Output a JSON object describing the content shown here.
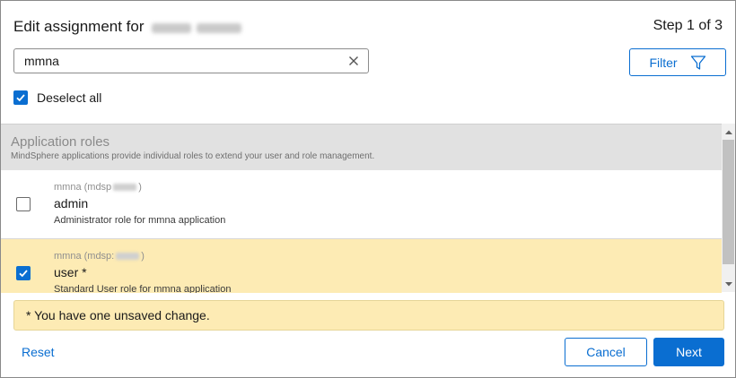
{
  "dialog": {
    "title": "Edit assignment for",
    "step": "Step 1 of 3"
  },
  "search": {
    "value": "mmna",
    "clear_icon": "close-icon"
  },
  "filter": {
    "label": "Filter",
    "icon": "funnel-icon"
  },
  "deselect_all": {
    "label": "Deselect all",
    "checked": true
  },
  "group": {
    "title": "Application roles",
    "subtitle": "MindSphere applications provide individual roles to extend your user and role management."
  },
  "roles": [
    {
      "app_prefix": "mmna (mdsp",
      "app_suffix": ")",
      "name": "admin",
      "description": "Administrator role for mmna application",
      "checked": false
    },
    {
      "app_prefix": "mmna (mdsp:",
      "app_suffix": ")",
      "name": "user *",
      "description": "Standard User role for mmna application",
      "checked": true
    }
  ],
  "notice": "* You have one unsaved change.",
  "footer": {
    "reset": "Reset",
    "cancel": "Cancel",
    "next": "Next"
  },
  "colors": {
    "accent": "#0a6ed1",
    "selected_row": "#fdebb4",
    "group_header": "#e1e1e1"
  }
}
